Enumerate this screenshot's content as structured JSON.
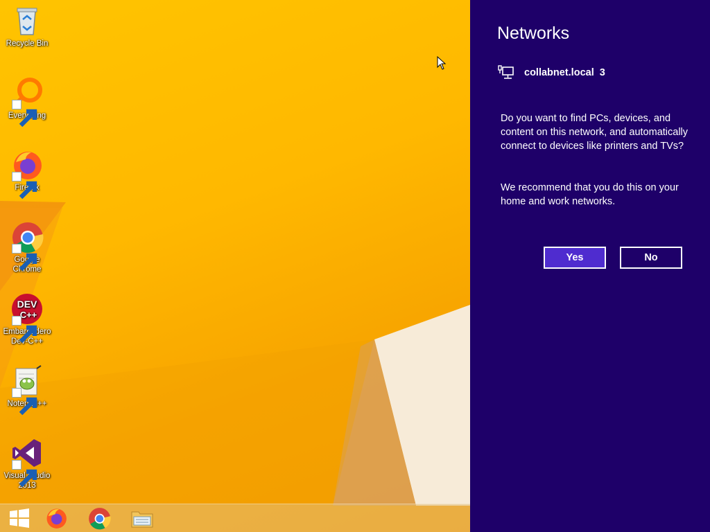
{
  "desktop": {
    "icons": [
      {
        "label": "Recycle Bin",
        "icon": "recycle-bin-icon"
      },
      {
        "label": "Everything",
        "icon": "everything-icon"
      },
      {
        "label": "Firefox",
        "icon": "firefox-icon"
      },
      {
        "label": "Google Chrome",
        "icon": "chrome-icon"
      },
      {
        "label": "Embarcadero Dev-C++",
        "icon": "devcpp-icon"
      },
      {
        "label": "Notepad++",
        "icon": "notepadpp-icon"
      },
      {
        "label": "Visual Studio 2013",
        "icon": "visual-studio-icon"
      }
    ]
  },
  "taskbar": {
    "items": [
      {
        "icon": "windows-start-icon"
      },
      {
        "icon": "firefox-icon"
      },
      {
        "icon": "chrome-icon"
      },
      {
        "icon": "file-explorer-icon"
      }
    ]
  },
  "networks_panel": {
    "title": "Networks",
    "network_name": "collabnet.local",
    "network_count": "3",
    "network_icon": "wired-network-icon",
    "question": "Do you want to find PCs, devices, and content on this network, and automatically connect to devices like printers and TVs?",
    "recommendation": "We recommend that you do this on your home and work networks.",
    "yes_label": "Yes",
    "no_label": "No"
  },
  "colors": {
    "panel_bg": "#1e0069",
    "yes_button_bg": "#4f2ccf",
    "wallpaper": "#ffb800"
  }
}
